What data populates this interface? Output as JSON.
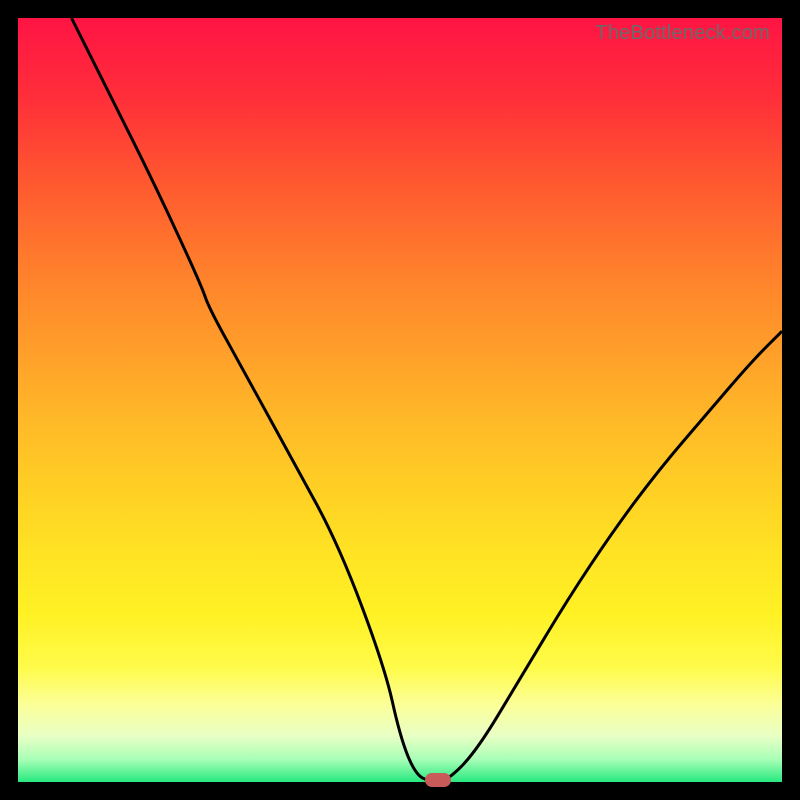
{
  "watermark": "TheBottleneck.com",
  "colors": {
    "curve": "#000000",
    "marker": "#c95a5a",
    "frame": "#000000"
  },
  "chart_data": {
    "type": "line",
    "title": "",
    "xlabel": "",
    "ylabel": "",
    "xlim": [
      0,
      100
    ],
    "ylim": [
      0,
      100
    ],
    "grid": false,
    "legend": false,
    "series": [
      {
        "name": "bottleneck-curve",
        "x": [
          7,
          12,
          18,
          24,
          25,
          30,
          36,
          42,
          48,
          50,
          52,
          54,
          56,
          60,
          66,
          72,
          78,
          84,
          90,
          96,
          100
        ],
        "y": [
          100,
          90,
          78,
          65,
          62,
          53,
          42,
          31,
          15,
          6,
          1,
          0,
          0,
          4,
          14,
          24,
          33,
          41,
          48,
          55,
          59
        ]
      }
    ],
    "marker": {
      "x": 55,
      "y": 0.3
    },
    "background_gradient": {
      "type": "vertical",
      "stops": [
        {
          "pos": 0,
          "color": "#ff1444"
        },
        {
          "pos": 50,
          "color": "#ffb728"
        },
        {
          "pos": 85,
          "color": "#fffb4a"
        },
        {
          "pos": 100,
          "color": "#28e97f"
        }
      ]
    }
  }
}
